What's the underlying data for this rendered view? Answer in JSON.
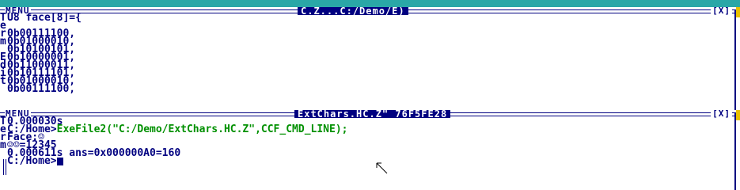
{
  "colors": {
    "text": "#000080",
    "accent": "#2aa7a7",
    "command": "#009000",
    "title_bg": "#000080",
    "title_fg": "#ffffff",
    "resize": "#e8c000"
  },
  "top_window": {
    "menu_label": "MENU",
    "title": "C.Z...C:/Demo/E)",
    "close_label": "[X]",
    "margin_letters": [
      "T",
      "e",
      "r",
      "m",
      "",
      "E",
      "d",
      "i",
      "t",
      ""
    ],
    "code_lines": [
      "U8 face[8]={",
      "",
      "0b00111100,",
      "0b01000010,",
      "0b10100101,",
      "0b10000001,",
      "0b11000011,",
      "0b10111101,",
      "0b01000010,",
      "0b00111100,"
    ]
  },
  "bottom_window": {
    "menu_label": "MENU",
    "title": "ExtChars.HC.Z\" 76F5FE28",
    "close_label": "[X]",
    "margin_letters": [
      "T",
      "e",
      "r",
      "m",
      "",
      ""
    ],
    "lines": [
      {
        "text": "0.000030s"
      },
      {
        "prompt": "C:/Home>",
        "command": "ExeFile2(\"C:/Demo/ExtChars.HC.Z\",CCF_CMD_LINE);"
      },
      {
        "text": "Face:☺"
      },
      {
        "text": "☺☺=12345"
      },
      {
        "text": "0.000611s ans=0x000000A0=160"
      },
      {
        "prompt": "C:/Home>"
      }
    ]
  },
  "icons": {
    "cursor": "mouse-arrow-icon"
  }
}
